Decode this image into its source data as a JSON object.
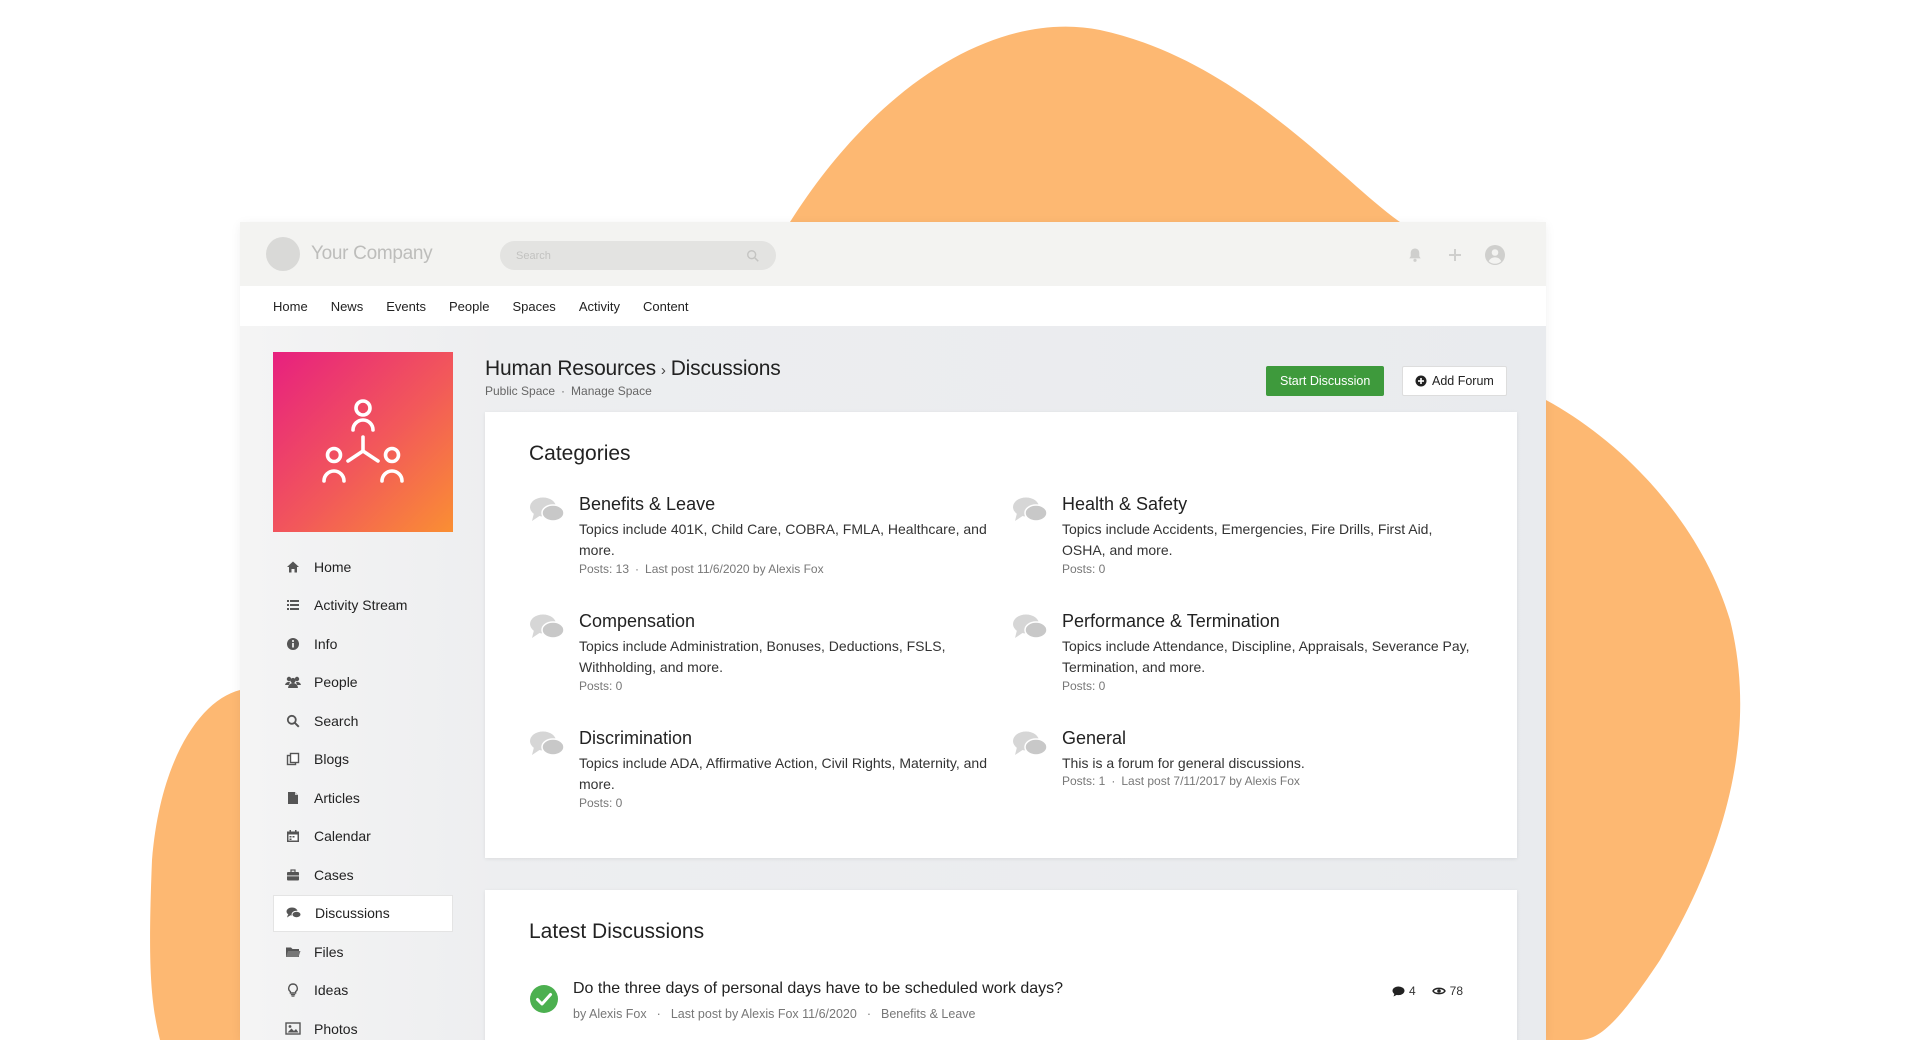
{
  "brand": {
    "company_name": "Your Company",
    "accent_orange": "#fdb872",
    "accent_green": "#3e9a3c"
  },
  "topbar": {
    "search_placeholder": "Search",
    "icons": [
      "bell-icon",
      "plus-icon",
      "user-circle-icon"
    ]
  },
  "topnav": [
    "Home",
    "News",
    "Events",
    "People",
    "Spaces",
    "Activity",
    "Content"
  ],
  "sidebar": {
    "items": [
      {
        "label": "Home",
        "icon": "home-icon"
      },
      {
        "label": "Activity Stream",
        "icon": "list-icon"
      },
      {
        "label": "Info",
        "icon": "info-icon"
      },
      {
        "label": "People",
        "icon": "people-icon"
      },
      {
        "label": "Search",
        "icon": "search-icon"
      },
      {
        "label": "Blogs",
        "icon": "blogs-icon"
      },
      {
        "label": "Articles",
        "icon": "article-icon"
      },
      {
        "label": "Calendar",
        "icon": "calendar-icon"
      },
      {
        "label": "Cases",
        "icon": "briefcase-icon"
      },
      {
        "label": "Discussions",
        "icon": "chat-icon",
        "active": true
      },
      {
        "label": "Files",
        "icon": "folder-icon"
      },
      {
        "label": "Ideas",
        "icon": "lightbulb-icon"
      },
      {
        "label": "Photos",
        "icon": "photo-icon"
      }
    ]
  },
  "header": {
    "space": "Human Resources",
    "page": "Discussions",
    "visibility": "Public Space",
    "manage": "Manage Space",
    "start_button": "Start Discussion",
    "add_button": "Add Forum"
  },
  "categories": {
    "title": "Categories",
    "items": [
      {
        "name": "Benefits & Leave",
        "desc": "Topics include 401K, Child Care, COBRA, FMLA, Healthcare, and more.",
        "posts": "Posts: 13",
        "last": "Last post 11/6/2020 by Alexis Fox"
      },
      {
        "name": "Health & Safety",
        "desc": "Topics include Accidents, Emergencies, Fire Drills, First Aid, OSHA, and more.",
        "posts": "Posts: 0",
        "last": ""
      },
      {
        "name": "Compensation",
        "desc": "Topics include Administration, Bonuses, Deductions, FSLS, Withholding, and more.",
        "posts": "Posts: 0",
        "last": ""
      },
      {
        "name": "Performance & Termination",
        "desc": "Topics include Attendance, Discipline, Appraisals, Severance Pay, Termination, and more.",
        "posts": "Posts: 0",
        "last": ""
      },
      {
        "name": "Discrimination",
        "desc": "Topics include ADA, Affirmative Action, Civil Rights, Maternity, and more.",
        "posts": "Posts: 0",
        "last": ""
      },
      {
        "name": "General",
        "desc": "This is a forum for general discussions.",
        "posts": "Posts: 1",
        "last": "Last post 7/11/2017 by Alexis Fox"
      }
    ]
  },
  "latest": {
    "title": "Latest Discussions",
    "items": [
      {
        "title": "Do the three days of personal days have to be scheduled work days?",
        "author": "by Alexis Fox",
        "last": "Last post by Alexis Fox 11/6/2020",
        "category": "Benefits & Leave",
        "comments": "4",
        "views": "78"
      }
    ]
  }
}
